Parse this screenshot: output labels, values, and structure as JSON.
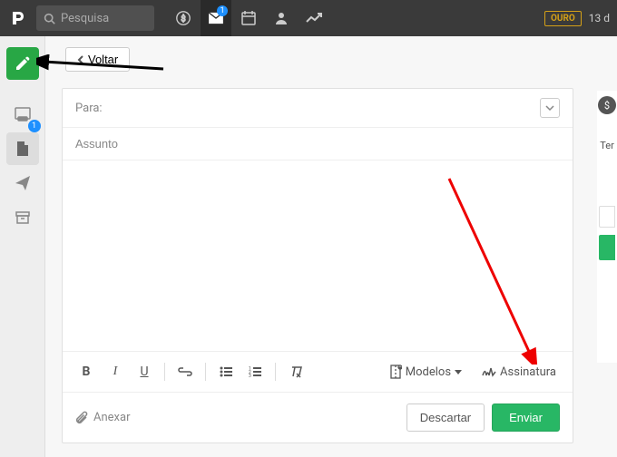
{
  "header": {
    "search_placeholder": "Pesquisa",
    "mail_badge": "1",
    "gold_label": "OURO",
    "days_text": "13 d"
  },
  "sidebar": {
    "inbox_badge": "1"
  },
  "main": {
    "back_label": "Voltar",
    "to_label": "Para:",
    "subject_placeholder": "Assunto"
  },
  "toolbar": {
    "bold": "B",
    "italic": "I",
    "underline": "U",
    "templates_label": "Modelos",
    "signature_label": "Assinatura"
  },
  "footer": {
    "attach_label": "Anexar",
    "discard_label": "Descartar",
    "send_label": "Enviar"
  },
  "right": {
    "text": "Ter"
  }
}
